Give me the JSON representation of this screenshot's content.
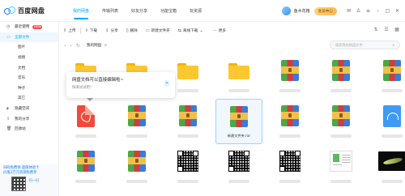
{
  "header": {
    "app_title": "百度网盘",
    "tabs": [
      {
        "label": "我的网盘",
        "active": true
      },
      {
        "label": "传输列表"
      },
      {
        "label": "好友分享"
      },
      {
        "label": "功能宝箱"
      },
      {
        "label": "玩资源"
      }
    ],
    "username": "鱼木花格",
    "vip_label": "会员中心"
  },
  "sidebar": {
    "items": [
      {
        "label": "最近使用",
        "badge": "NEW",
        "icon": "clock-icon"
      },
      {
        "label": "全部文件",
        "active": true,
        "icon": "folder-icon"
      },
      {
        "label": "图片",
        "sub": true
      },
      {
        "label": "视频",
        "sub": true
      },
      {
        "label": "文档",
        "sub": true
      },
      {
        "label": "音乐",
        "sub": true
      },
      {
        "label": "种子",
        "sub": true
      },
      {
        "label": "其它",
        "sub": true
      },
      {
        "label": "隐藏空间",
        "icon": "lock-icon"
      },
      {
        "label": "我的分享",
        "icon": "share-icon"
      },
      {
        "label": "回收站",
        "icon": "trash-icon"
      }
    ],
    "promo_line1": "扫码免费领 超值体验卡",
    "promo_line2": "价值2万元资源免费享",
    "promo_scan": "扫一扫"
  },
  "toolbar": {
    "upload": "上传",
    "download": "下载",
    "share": "分享",
    "delete": "删除",
    "new_folder": "新建文件夹",
    "offline_download": "离线下载",
    "more": "更多"
  },
  "breadcrumb": {
    "root": "我的网盘",
    "separator": ">"
  },
  "search": {
    "placeholder": "搜索我的网盘文件"
  },
  "tooltip": {
    "title": "网盘文档可以直接编辑啦~",
    "subtitle": "快来试试吧！"
  },
  "files": [
    {
      "type": "folder",
      "name": ""
    },
    {
      "type": "folder",
      "name": ""
    },
    {
      "type": "folder",
      "name": ""
    },
    {
      "type": "folder",
      "name": ""
    },
    {
      "type": "rar",
      "name": ""
    },
    {
      "type": "rar",
      "name": ""
    },
    {
      "type": "rar",
      "name": ""
    },
    {
      "type": "pdf",
      "name": ""
    },
    {
      "type": "rar",
      "name": ""
    },
    {
      "type": "rar",
      "name": ""
    },
    {
      "type": "rar",
      "name": "新建文件夹.rar",
      "selected": true
    },
    {
      "type": "rar",
      "name": ""
    },
    {
      "type": "rar",
      "name": ""
    },
    {
      "type": "cloud",
      "name": ""
    },
    {
      "type": "rar",
      "name": ""
    },
    {
      "type": "rar",
      "name": ""
    },
    {
      "type": "qr",
      "name": ""
    },
    {
      "type": "qr",
      "name": ""
    },
    {
      "type": "qr",
      "name": ""
    },
    {
      "type": "doc",
      "name": ""
    },
    {
      "type": "video",
      "name": ""
    }
  ]
}
